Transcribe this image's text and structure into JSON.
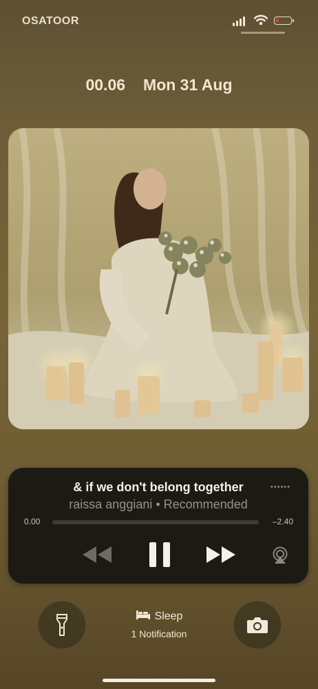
{
  "status": {
    "carrier": "OSATOOR",
    "battery_color": "#ff3b30"
  },
  "lockscreen": {
    "time": "00.06",
    "date": "Mon 31 Aug"
  },
  "player": {
    "song_title": "& if we don't belong together",
    "artist_line": "raissa anggiani • Recommended",
    "elapsed": "0.00",
    "remaining": "–2.40",
    "progress_percent": 0,
    "icons": {
      "rewind": "rewind-icon",
      "pause": "pause-icon",
      "forward": "fast-forward-icon",
      "airplay": "airplay-icon",
      "more": "more-dots-icon"
    }
  },
  "bottom": {
    "focus_label": "Sleep",
    "notification_text": "1 Notification",
    "left_button_icon": "flashlight-icon",
    "right_button_icon": "camera-icon"
  },
  "colors": {
    "background": "#776538",
    "player_bg": "#1c1a14"
  }
}
